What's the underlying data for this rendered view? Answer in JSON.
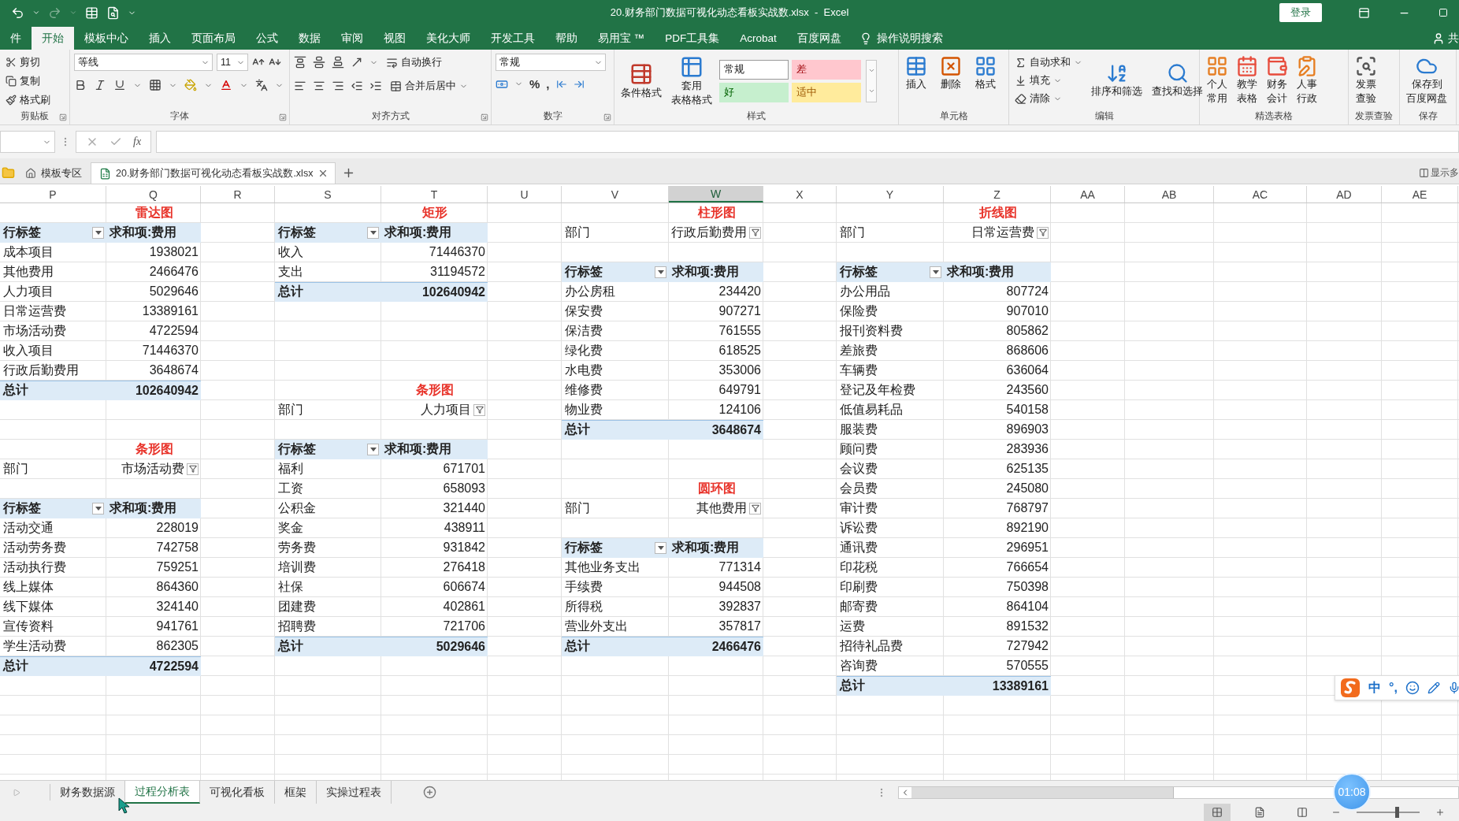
{
  "title_bar": {
    "title": "20.财务部门数据可视化动态看板实战数.xlsx  -  Excel",
    "login": "登录"
  },
  "menu_tabs": [
    {
      "label": "件",
      "selected": false
    },
    {
      "label": "开始",
      "selected": true
    },
    {
      "label": "模板中心",
      "selected": false
    },
    {
      "label": "插入",
      "selected": false
    },
    {
      "label": "页面布局",
      "selected": false
    },
    {
      "label": "公式",
      "selected": false
    },
    {
      "label": "数据",
      "selected": false
    },
    {
      "label": "审阅",
      "selected": false
    },
    {
      "label": "视图",
      "selected": false
    },
    {
      "label": "美化大师",
      "selected": false
    },
    {
      "label": "开发工具",
      "selected": false
    },
    {
      "label": "帮助",
      "selected": false
    },
    {
      "label": "易用宝 ™",
      "selected": false
    },
    {
      "label": "PDF工具集",
      "selected": false
    },
    {
      "label": "Acrobat",
      "selected": false
    },
    {
      "label": "百度网盘",
      "selected": false
    }
  ],
  "tell_me": "操作说明搜索",
  "share": "共",
  "ribbon": [
    {
      "kind": "clipboard",
      "label": "剪贴板",
      "items": [
        "剪切",
        "复制",
        "格式刷"
      ]
    },
    {
      "kind": "font",
      "label": "字体",
      "font": "等线",
      "size": "11"
    },
    {
      "kind": "alignment",
      "label": "对齐方式",
      "items": [
        "自动换行",
        "合并后居中"
      ]
    },
    {
      "kind": "number",
      "label": "数字",
      "format": "常规",
      "symbols": [
        "%",
        ","
      ]
    },
    {
      "kind": "styles",
      "label": "样式",
      "buttons": [
        [
          "条件格式"
        ],
        [
          "套用",
          "表格格式"
        ]
      ],
      "cells": [
        {
          "label": "常规",
          "kind": "normal"
        },
        {
          "label": "差",
          "kind": "bad"
        },
        {
          "label": "好",
          "kind": "good"
        },
        {
          "label": "适中",
          "kind": "neutral"
        }
      ]
    },
    {
      "kind": "cells",
      "label": "单元格",
      "buttons": [
        [
          "插入"
        ],
        [
          "删除"
        ],
        [
          "格式"
        ]
      ]
    },
    {
      "kind": "editing",
      "label": "编辑",
      "items": [
        "自动求和",
        "填充",
        "清除"
      ],
      "buttons": [
        [
          "排序和筛选"
        ],
        [
          "查找和选择"
        ]
      ]
    },
    {
      "kind": "featured",
      "label": "精选表格",
      "buttons": [
        [
          "个人",
          "常用"
        ],
        [
          "教学",
          "表格"
        ],
        [
          "财务",
          "会计"
        ],
        [
          "人事",
          "行政"
        ]
      ]
    },
    {
      "kind": "invoice",
      "label": "发票查验",
      "buttons": [
        [
          "发票",
          "查验"
        ]
      ]
    },
    {
      "kind": "save",
      "label": "保存",
      "buttons": [
        [
          "保存到",
          "百度网盘"
        ]
      ]
    }
  ],
  "formula_bar": {
    "function_label": "fx"
  },
  "workbook_tabs": [
    {
      "label": "模板专区",
      "kind": "home",
      "selected": false
    },
    {
      "label": "20.财务部门数据可视化动态看板实战数.xlsx",
      "kind": "file",
      "selected": true
    }
  ],
  "multi_window": "显示多",
  "sheet": {
    "columns": [
      {
        "label": "P",
        "selected": false
      },
      {
        "label": "Q",
        "selected": false
      },
      {
        "label": "R",
        "selected": false
      },
      {
        "label": "S",
        "selected": false
      },
      {
        "label": "T",
        "selected": false
      },
      {
        "label": "U",
        "selected": false
      },
      {
        "label": "V",
        "selected": false
      },
      {
        "label": "W",
        "selected": true
      },
      {
        "label": "X",
        "selected": false
      },
      {
        "label": "Y",
        "selected": false
      },
      {
        "label": "Z",
        "selected": false
      },
      {
        "label": "AA",
        "selected": false
      },
      {
        "label": "AB",
        "selected": false
      },
      {
        "label": "AC",
        "selected": false
      },
      {
        "label": "AD",
        "selected": false
      },
      {
        "label": "AE",
        "selected": false
      }
    ],
    "rows": [
      {
        "Q": {
          "kind": "title",
          "text": "雷达图"
        },
        "T": {
          "kind": "title",
          "text": "矩形"
        },
        "W": {
          "kind": "title",
          "text": "柱形图"
        },
        "Z": {
          "kind": "title",
          "text": "折线图"
        }
      },
      {
        "P": {
          "kind": "row_header",
          "text": "行标签"
        },
        "Q": {
          "kind": "value_header",
          "text": "求和项:费用"
        },
        "S": {
          "kind": "row_header",
          "text": "行标签"
        },
        "T": {
          "kind": "value_header",
          "text": "求和项:费用"
        },
        "V": {
          "kind": "page_label",
          "text": "部门"
        },
        "W": {
          "kind": "page_value",
          "text": "行政后勤费用"
        },
        "Y": {
          "kind": "page_label",
          "text": "部门"
        },
        "Z": {
          "kind": "page_value",
          "text": "日常运营费"
        }
      },
      {
        "P": {
          "kind": "label",
          "text": "成本项目"
        },
        "Q": {
          "kind": "value",
          "text": "1938021"
        },
        "S": {
          "kind": "label",
          "text": "收入"
        },
        "T": {
          "kind": "value",
          "text": "71446370"
        }
      },
      {
        "P": {
          "kind": "label",
          "text": "其他费用"
        },
        "Q": {
          "kind": "value",
          "text": "2466476"
        },
        "S": {
          "kind": "label",
          "text": "支出"
        },
        "T": {
          "kind": "value",
          "text": "31194572"
        },
        "V": {
          "kind": "row_header",
          "text": "行标签"
        },
        "W": {
          "kind": "value_header",
          "text": "求和项:费用"
        },
        "Y": {
          "kind": "row_header",
          "text": "行标签"
        },
        "Z": {
          "kind": "value_header",
          "text": "求和项:费用"
        }
      },
      {
        "P": {
          "kind": "label",
          "text": "人力项目"
        },
        "Q": {
          "kind": "value",
          "text": "5029646"
        },
        "S": {
          "kind": "total_label",
          "text": "总计"
        },
        "T": {
          "kind": "total_value",
          "text": "102640942"
        },
        "V": {
          "kind": "label",
          "text": "办公房租"
        },
        "W": {
          "kind": "value",
          "text": "234420"
        },
        "Y": {
          "kind": "label",
          "text": "办公用品"
        },
        "Z": {
          "kind": "value",
          "text": "807724"
        }
      },
      {
        "P": {
          "kind": "label",
          "text": "日常运营费"
        },
        "Q": {
          "kind": "value",
          "text": "13389161"
        },
        "V": {
          "kind": "label",
          "text": "保安费"
        },
        "W": {
          "kind": "value",
          "text": "907271"
        },
        "Y": {
          "kind": "label",
          "text": "保险费"
        },
        "Z": {
          "kind": "value",
          "text": "907010"
        }
      },
      {
        "P": {
          "kind": "label",
          "text": "市场活动费"
        },
        "Q": {
          "kind": "value",
          "text": "4722594"
        },
        "V": {
          "kind": "label",
          "text": "保洁费"
        },
        "W": {
          "kind": "value",
          "text": "761555"
        },
        "Y": {
          "kind": "label",
          "text": "报刊资料费"
        },
        "Z": {
          "kind": "value",
          "text": "805862"
        }
      },
      {
        "P": {
          "kind": "label",
          "text": "收入项目"
        },
        "Q": {
          "kind": "value",
          "text": "71446370"
        },
        "V": {
          "kind": "label",
          "text": "绿化费"
        },
        "W": {
          "kind": "value",
          "text": "618525"
        },
        "Y": {
          "kind": "label",
          "text": "差旅费"
        },
        "Z": {
          "kind": "value",
          "text": "868606"
        }
      },
      {
        "P": {
          "kind": "label",
          "text": "行政后勤费用"
        },
        "Q": {
          "kind": "value",
          "text": "3648674"
        },
        "V": {
          "kind": "label",
          "text": "水电费"
        },
        "W": {
          "kind": "value",
          "text": "353006"
        },
        "Y": {
          "kind": "label",
          "text": "车辆费"
        },
        "Z": {
          "kind": "value",
          "text": "636064"
        }
      },
      {
        "P": {
          "kind": "total_label",
          "text": "总计"
        },
        "Q": {
          "kind": "total_value",
          "text": "102640942"
        },
        "T": {
          "kind": "title",
          "text": "条形图"
        },
        "V": {
          "kind": "label",
          "text": "维修费"
        },
        "W": {
          "kind": "value",
          "text": "649791"
        },
        "Y": {
          "kind": "label",
          "text": "登记及年检费"
        },
        "Z": {
          "kind": "value",
          "text": "243560"
        }
      },
      {
        "S": {
          "kind": "page_label",
          "text": "部门"
        },
        "T": {
          "kind": "page_value",
          "text": "人力项目"
        },
        "V": {
          "kind": "label",
          "text": "物业费"
        },
        "W": {
          "kind": "value",
          "text": "124106"
        },
        "Y": {
          "kind": "label",
          "text": "低值易耗品"
        },
        "Z": {
          "kind": "value",
          "text": "540158"
        }
      },
      {
        "V": {
          "kind": "total_label",
          "text": "总计"
        },
        "W": {
          "kind": "total_value",
          "text": "3648674"
        },
        "Y": {
          "kind": "label",
          "text": "服装费"
        },
        "Z": {
          "kind": "value",
          "text": "896903"
        }
      },
      {
        "Q": {
          "kind": "title",
          "text": "条形图"
        },
        "S": {
          "kind": "row_header",
          "text": "行标签"
        },
        "T": {
          "kind": "value_header",
          "text": "求和项:费用"
        },
        "Y": {
          "kind": "label",
          "text": "顾问费"
        },
        "Z": {
          "kind": "value",
          "text": "283936"
        }
      },
      {
        "P": {
          "kind": "page_label",
          "text": "部门"
        },
        "Q": {
          "kind": "page_value",
          "text": "市场活动费"
        },
        "S": {
          "kind": "label",
          "text": "福利"
        },
        "T": {
          "kind": "value",
          "text": "671701"
        },
        "Y": {
          "kind": "label",
          "text": "会议费"
        },
        "Z": {
          "kind": "value",
          "text": "625135"
        }
      },
      {
        "S": {
          "kind": "label",
          "text": "工资"
        },
        "T": {
          "kind": "value",
          "text": "658093"
        },
        "W": {
          "kind": "title",
          "text": "圆环图"
        },
        "Y": {
          "kind": "label",
          "text": "会员费"
        },
        "Z": {
          "kind": "value",
          "text": "245080"
        }
      },
      {
        "P": {
          "kind": "row_header",
          "text": "行标签"
        },
        "Q": {
          "kind": "value_header",
          "text": "求和项:费用"
        },
        "S": {
          "kind": "label",
          "text": "公积金"
        },
        "T": {
          "kind": "value",
          "text": "321440"
        },
        "V": {
          "kind": "page_label",
          "text": "部门"
        },
        "W": {
          "kind": "page_value",
          "text": "其他费用"
        },
        "Y": {
          "kind": "label",
          "text": "审计费"
        },
        "Z": {
          "kind": "value",
          "text": "768797"
        }
      },
      {
        "P": {
          "kind": "label",
          "text": "活动交通"
        },
        "Q": {
          "kind": "value",
          "text": "228019"
        },
        "S": {
          "kind": "label",
          "text": "奖金"
        },
        "T": {
          "kind": "value",
          "text": "438911"
        },
        "Y": {
          "kind": "label",
          "text": "诉讼费"
        },
        "Z": {
          "kind": "value",
          "text": "892190"
        }
      },
      {
        "P": {
          "kind": "label",
          "text": "活动劳务费"
        },
        "Q": {
          "kind": "value",
          "text": "742758"
        },
        "S": {
          "kind": "label",
          "text": "劳务费"
        },
        "T": {
          "kind": "value",
          "text": "931842"
        },
        "V": {
          "kind": "row_header",
          "text": "行标签"
        },
        "W": {
          "kind": "value_header",
          "text": "求和项:费用"
        },
        "Y": {
          "kind": "label",
          "text": "通讯费"
        },
        "Z": {
          "kind": "value",
          "text": "296951"
        }
      },
      {
        "P": {
          "kind": "label",
          "text": "活动执行费"
        },
        "Q": {
          "kind": "value",
          "text": "759251"
        },
        "S": {
          "kind": "label",
          "text": "培训费"
        },
        "T": {
          "kind": "value",
          "text": "276418"
        },
        "V": {
          "kind": "label",
          "text": "其他业务支出"
        },
        "W": {
          "kind": "value",
          "text": "771314"
        },
        "Y": {
          "kind": "label",
          "text": "印花税"
        },
        "Z": {
          "kind": "value",
          "text": "766654"
        }
      },
      {
        "P": {
          "kind": "label",
          "text": "线上媒体"
        },
        "Q": {
          "kind": "value",
          "text": "864360"
        },
        "S": {
          "kind": "label",
          "text": "社保"
        },
        "T": {
          "kind": "value",
          "text": "606674"
        },
        "V": {
          "kind": "label",
          "text": "手续费"
        },
        "W": {
          "kind": "value",
          "text": "944508"
        },
        "Y": {
          "kind": "label",
          "text": "印刷费"
        },
        "Z": {
          "kind": "value",
          "text": "750398"
        }
      },
      {
        "P": {
          "kind": "label",
          "text": "线下媒体"
        },
        "Q": {
          "kind": "value",
          "text": "324140"
        },
        "S": {
          "kind": "label",
          "text": "团建费"
        },
        "T": {
          "kind": "value",
          "text": "402861"
        },
        "V": {
          "kind": "label",
          "text": "所得税"
        },
        "W": {
          "kind": "value",
          "text": "392837"
        },
        "Y": {
          "kind": "label",
          "text": "邮寄费"
        },
        "Z": {
          "kind": "value",
          "text": "864104"
        }
      },
      {
        "P": {
          "kind": "label",
          "text": "宣传资料"
        },
        "Q": {
          "kind": "value",
          "text": "941761"
        },
        "S": {
          "kind": "label",
          "text": "招聘费"
        },
        "T": {
          "kind": "value",
          "text": "721706"
        },
        "V": {
          "kind": "label",
          "text": "营业外支出"
        },
        "W": {
          "kind": "value",
          "text": "357817"
        },
        "Y": {
          "kind": "label",
          "text": "运费"
        },
        "Z": {
          "kind": "value",
          "text": "891532"
        }
      },
      {
        "P": {
          "kind": "label",
          "text": "学生活动费"
        },
        "Q": {
          "kind": "value",
          "text": "862305"
        },
        "S": {
          "kind": "total_label",
          "text": "总计"
        },
        "T": {
          "kind": "total_value",
          "text": "5029646"
        },
        "V": {
          "kind": "total_label",
          "text": "总计"
        },
        "W": {
          "kind": "total_value",
          "text": "2466476"
        },
        "Y": {
          "kind": "label",
          "text": "招待礼品费"
        },
        "Z": {
          "kind": "value",
          "text": "727942"
        }
      },
      {
        "P": {
          "kind": "total_label",
          "text": "总计"
        },
        "Q": {
          "kind": "total_value",
          "text": "4722594"
        },
        "Y": {
          "kind": "label",
          "text": "咨询费"
        },
        "Z": {
          "kind": "value",
          "text": "570555"
        }
      },
      {
        "Y": {
          "kind": "total_label",
          "text": "总计"
        },
        "Z": {
          "kind": "total_value",
          "text": "13389161"
        }
      },
      {},
      {},
      {},
      {},
      {}
    ]
  },
  "sheet_tabs": [
    {
      "label": "财务数据源",
      "selected": false
    },
    {
      "label": "过程分析表",
      "selected": true
    },
    {
      "label": "可视化看板",
      "selected": false
    },
    {
      "label": "框架",
      "selected": false
    },
    {
      "label": "实操过程表",
      "selected": false
    }
  ],
  "zoom": {
    "level": 0.65
  },
  "ime": {
    "mode": "中",
    "punctuation": "°,"
  },
  "timer": "01:08"
}
